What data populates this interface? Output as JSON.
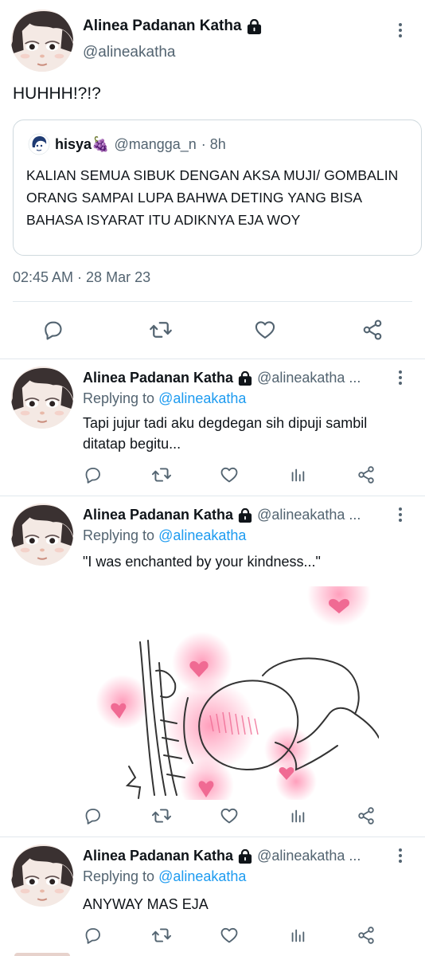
{
  "main_tweet": {
    "author_name": "Alinea Padanan Katha",
    "author_handle": "@alineakatha",
    "text": "HUHHH!?!?",
    "quote": {
      "author_name": "hisya🍇",
      "author_handle": "@mangga_n",
      "time": "· 8h",
      "text": "KALIAN SEMUA SIBUK DENGAN AKSA MUJI/ GOMBALIN ORANG SAMPAI LUPA BAHWA DETING YANG BISA BAHASA ISYARAT ITU ADIKNYA EJA WOY"
    },
    "timestamp": "02:45 AM · 28 Mar 23"
  },
  "replies": [
    {
      "author_name": "Alinea Padanan Katha",
      "author_handle": "@alineakatha ...",
      "replying_prefix": "Replying to ",
      "replying_to": "@alineakatha",
      "text": "Tapi jujur tadi aku degdegan sih dipuji sambil ditatap begitu..."
    },
    {
      "author_name": "Alinea Padanan Katha",
      "author_handle": "@alineakatha ...",
      "replying_prefix": "Replying to ",
      "replying_to": "@alineakatha",
      "text": "\"I was enchanted by your kindness...\""
    },
    {
      "author_name": "Alinea Padanan Katha",
      "author_handle": "@alineakatha ...",
      "replying_prefix": "Replying to ",
      "replying_to": "@alineakatha",
      "text": "ANYWAY MAS EJA"
    }
  ],
  "icons": {
    "reply": "reply-icon",
    "retweet": "retweet-icon",
    "like": "heart-icon",
    "share": "share-icon",
    "analytics": "analytics-icon",
    "more": "more-vertical-icon",
    "lock": "lock-icon"
  },
  "colors": {
    "text": "#0f1419",
    "secondary": "#536471",
    "link": "#1d9bf0",
    "divider": "#e1e8ed"
  }
}
